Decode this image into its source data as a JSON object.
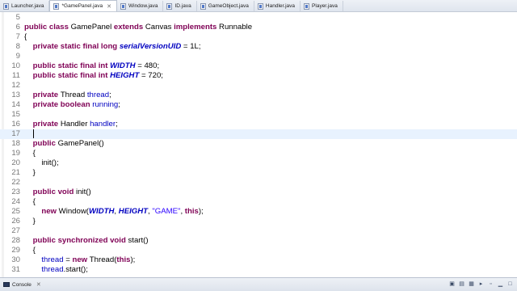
{
  "tabs": [
    {
      "label": "Launcher.java",
      "active": false
    },
    {
      "label": "*GamePanel.java",
      "active": true,
      "close": "✕"
    },
    {
      "label": "Window.java",
      "active": false
    },
    {
      "label": "ID.java",
      "active": false
    },
    {
      "label": "GameObject.java",
      "active": false
    },
    {
      "label": "Handler.java",
      "active": false
    },
    {
      "label": "Player.java",
      "active": false
    }
  ],
  "editor": {
    "current_line": 17,
    "lines": [
      {
        "n": "5",
        "tokens": []
      },
      {
        "n": "6",
        "tokens": [
          {
            "t": "kw",
            "v": "public class "
          },
          {
            "t": "pl",
            "v": "GamePanel "
          },
          {
            "t": "kw",
            "v": "extends "
          },
          {
            "t": "pl",
            "v": "Canvas "
          },
          {
            "t": "kw",
            "v": "implements "
          },
          {
            "t": "pl",
            "v": "Runnable"
          }
        ]
      },
      {
        "n": "7",
        "tokens": [
          {
            "t": "pl",
            "v": "{"
          }
        ]
      },
      {
        "n": "8",
        "tokens": [
          {
            "t": "pl",
            "v": "    "
          },
          {
            "t": "kw",
            "v": "private static final long "
          },
          {
            "t": "cst",
            "v": "serialVersionUID"
          },
          {
            "t": "pl",
            "v": " = 1L;"
          }
        ]
      },
      {
        "n": "9",
        "tokens": []
      },
      {
        "n": "10",
        "tokens": [
          {
            "t": "pl",
            "v": "    "
          },
          {
            "t": "kw",
            "v": "public static final int "
          },
          {
            "t": "cst",
            "v": "WIDTH"
          },
          {
            "t": "pl",
            "v": " = 480;"
          }
        ]
      },
      {
        "n": "11",
        "tokens": [
          {
            "t": "pl",
            "v": "    "
          },
          {
            "t": "kw",
            "v": "public static final int "
          },
          {
            "t": "cst",
            "v": "HEIGHT"
          },
          {
            "t": "pl",
            "v": " = 720;"
          }
        ]
      },
      {
        "n": "12",
        "tokens": []
      },
      {
        "n": "13",
        "tokens": [
          {
            "t": "pl",
            "v": "    "
          },
          {
            "t": "kw",
            "v": "private "
          },
          {
            "t": "pl",
            "v": "Thread "
          },
          {
            "t": "fld",
            "v": "thread"
          },
          {
            "t": "pl",
            "v": ";"
          }
        ]
      },
      {
        "n": "14",
        "tokens": [
          {
            "t": "pl",
            "v": "    "
          },
          {
            "t": "kw",
            "v": "private boolean "
          },
          {
            "t": "fld",
            "v": "running"
          },
          {
            "t": "pl",
            "v": ";"
          }
        ]
      },
      {
        "n": "15",
        "tokens": []
      },
      {
        "n": "16",
        "tokens": [
          {
            "t": "pl",
            "v": "    "
          },
          {
            "t": "kw",
            "v": "private "
          },
          {
            "t": "pl",
            "v": "Handler "
          },
          {
            "t": "fld",
            "v": "handler"
          },
          {
            "t": "pl",
            "v": ";"
          }
        ]
      },
      {
        "n": "17",
        "tokens": [
          {
            "t": "pl",
            "v": "    "
          },
          {
            "t": "caret",
            "v": ""
          }
        ]
      },
      {
        "n": "18",
        "tokens": [
          {
            "t": "pl",
            "v": "    "
          },
          {
            "t": "kw",
            "v": "public "
          },
          {
            "t": "pl",
            "v": "GamePanel()"
          }
        ]
      },
      {
        "n": "19",
        "tokens": [
          {
            "t": "pl",
            "v": "    {"
          }
        ]
      },
      {
        "n": "20",
        "tokens": [
          {
            "t": "pl",
            "v": "        init();"
          }
        ]
      },
      {
        "n": "21",
        "tokens": [
          {
            "t": "pl",
            "v": "    }"
          }
        ]
      },
      {
        "n": "22",
        "tokens": []
      },
      {
        "n": "23",
        "tokens": [
          {
            "t": "pl",
            "v": "    "
          },
          {
            "t": "kw",
            "v": "public void "
          },
          {
            "t": "pl",
            "v": "init()"
          }
        ]
      },
      {
        "n": "24",
        "tokens": [
          {
            "t": "pl",
            "v": "    {"
          }
        ]
      },
      {
        "n": "25",
        "tokens": [
          {
            "t": "pl",
            "v": "        "
          },
          {
            "t": "kw",
            "v": "new "
          },
          {
            "t": "pl",
            "v": "Window("
          },
          {
            "t": "cst",
            "v": "WIDTH"
          },
          {
            "t": "pl",
            "v": ", "
          },
          {
            "t": "cst",
            "v": "HEIGHT"
          },
          {
            "t": "pl",
            "v": ", "
          },
          {
            "t": "str",
            "v": "\"GAME\""
          },
          {
            "t": "pl",
            "v": ", "
          },
          {
            "t": "kw",
            "v": "this"
          },
          {
            "t": "pl",
            "v": ");"
          }
        ]
      },
      {
        "n": "26",
        "tokens": [
          {
            "t": "pl",
            "v": "    }"
          }
        ]
      },
      {
        "n": "27",
        "tokens": []
      },
      {
        "n": "28",
        "tokens": [
          {
            "t": "pl",
            "v": "    "
          },
          {
            "t": "kw",
            "v": "public synchronized void "
          },
          {
            "t": "pl",
            "v": "start()"
          }
        ]
      },
      {
        "n": "29",
        "tokens": [
          {
            "t": "pl",
            "v": "    {"
          }
        ]
      },
      {
        "n": "30",
        "tokens": [
          {
            "t": "pl",
            "v": "        "
          },
          {
            "t": "fld",
            "v": "thread"
          },
          {
            "t": "pl",
            "v": " = "
          },
          {
            "t": "kw",
            "v": "new "
          },
          {
            "t": "pl",
            "v": "Thread("
          },
          {
            "t": "kw",
            "v": "this"
          },
          {
            "t": "pl",
            "v": ");"
          }
        ]
      },
      {
        "n": "31",
        "tokens": [
          {
            "t": "pl",
            "v": "        "
          },
          {
            "t": "fld",
            "v": "thread"
          },
          {
            "t": "pl",
            "v": ".start();"
          }
        ]
      }
    ]
  },
  "statusbar": {
    "console_label": "Console",
    "close": "✕",
    "tool_icons": [
      "▣",
      "▤",
      "▦",
      "▸",
      "▫",
      "▁",
      "□"
    ]
  },
  "colors": {
    "keyword": "#7f0055",
    "field": "#0000c0",
    "string": "#2a00ff",
    "current_line": "#e8f2fe"
  }
}
